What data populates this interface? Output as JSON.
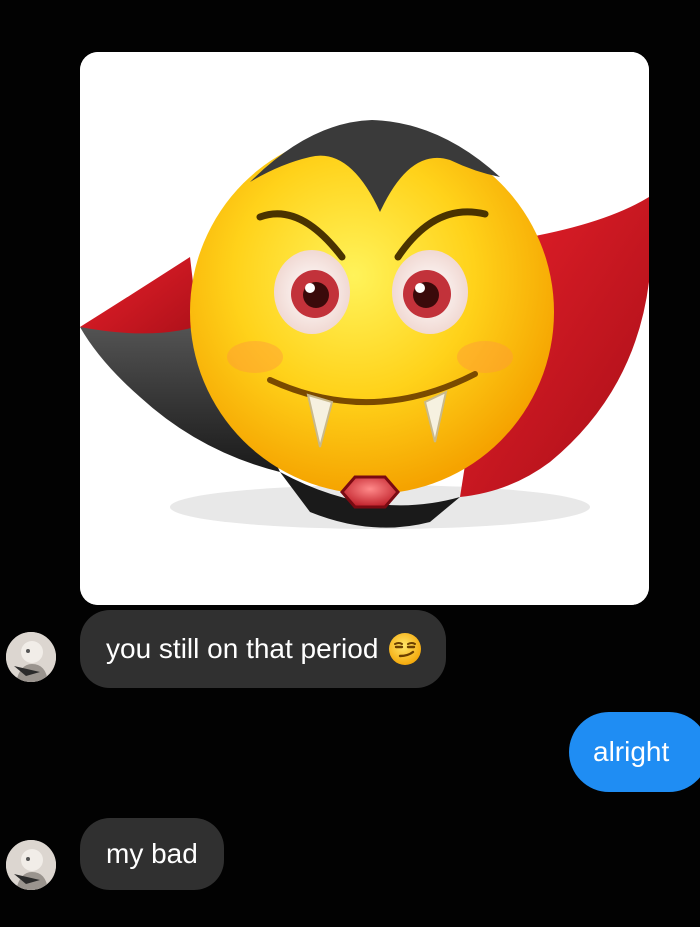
{
  "conversation": {
    "messages": [
      {
        "sender": "other",
        "type": "image",
        "image_icon": "vampire-emoji"
      },
      {
        "sender": "other",
        "type": "text",
        "text": "you still on that period",
        "emoji_icon": "smirking-face-emoji"
      },
      {
        "sender": "me",
        "type": "text",
        "text": "alright"
      },
      {
        "sender": "other",
        "type": "text",
        "text": "my bad"
      }
    ]
  },
  "colors": {
    "background": "#020202",
    "incoming_bubble": "#303030",
    "outgoing_bubble": "#1f8df3",
    "text": "#ffffff"
  }
}
